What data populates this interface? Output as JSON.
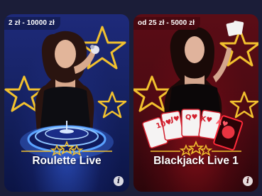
{
  "colors": {
    "page_background": "#1b1d38",
    "star_gold": "#f2c12e",
    "roulette_accent": "#3c6eff",
    "blackjack_accent": "#b4141e"
  },
  "cards": [
    {
      "stake_range": "2 zł - 10000 zł",
      "title": "Roulette Live",
      "info_icon": "info-icon"
    },
    {
      "stake_range": "od 25 zł - 5000 zł",
      "title": "Blackjack Live 1",
      "info_icon": "info-icon",
      "playing_cards": [
        "10♥",
        "J♥",
        "Q♥",
        "K♥",
        "A♥"
      ]
    }
  ]
}
